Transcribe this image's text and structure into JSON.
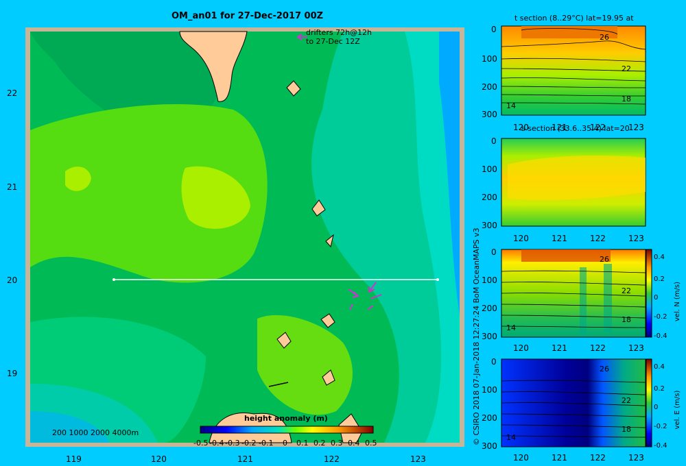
{
  "main_title": "OM_an01 for 27-Dec-2017 00Z",
  "drifters_line1": "drifters 72h@12h",
  "drifters_line2": "to 27-Dec 12Z",
  "depth_legend": "200  1000  2000  4000m",
  "credit": "© CSIRO 2018   07-Jan-2018 12:27:24 BoM OceanMAPS v3",
  "colorbar": {
    "title": "height anomaly (m)",
    "ticks": [
      "-0.5",
      "-0.4",
      "-0.3",
      "-0.2",
      "-0.1",
      "0",
      "0.1",
      "0.2",
      "0.3",
      "0.4",
      "0.5"
    ]
  },
  "panel_titles": [
    "t section (8..29°C) lat=19.95 at",
    "s section (33.6..35.4) lat=20"
  ],
  "vel_labels": [
    "vel. N (m/s)",
    "vel. E (m/s)"
  ],
  "vel_ticks": [
    "0.4",
    "0.2",
    "0",
    "-0.2",
    "-0.4"
  ],
  "colors": {
    "background": "#00ccff",
    "land": "#ffcc99",
    "bathy": "#c8b496"
  },
  "chart_data": [
    {
      "type": "heatmap",
      "title": "OM_an01 for 27-Dec-2017 00Z",
      "variable": "height anomaly (m)",
      "x_ticks": [
        "119",
        "120",
        "121",
        "122",
        "123"
      ],
      "y_ticks": [
        "22",
        "21",
        "20",
        "19"
      ],
      "xlim": [
        118.5,
        123.5
      ],
      "ylim": [
        18.3,
        22.7
      ],
      "colorbar_range": [
        -0.5,
        0.5
      ],
      "section_line": {
        "lat": 20,
        "lon_from": 119.5,
        "lon_to": 123.2
      }
    },
    {
      "type": "heatmap",
      "title": "t section (8..29°C) lat=19.95 at",
      "x_ticks": [
        "120",
        "121",
        "122",
        "123"
      ],
      "y_ticks": [
        "0",
        "100",
        "200",
        "300"
      ],
      "contour_labels": [
        "26",
        "22",
        "18",
        "14"
      ]
    },
    {
      "type": "heatmap",
      "title": "s section (33.6..35.4) lat=20",
      "x_ticks": [
        "120",
        "121",
        "122",
        "123"
      ],
      "y_ticks": [
        "0",
        "100",
        "200",
        "300"
      ]
    },
    {
      "type": "heatmap",
      "title": "vel. N (m/s)",
      "x_ticks": [
        "120",
        "121",
        "122",
        "123"
      ],
      "y_ticks": [
        "0",
        "100",
        "200",
        "300"
      ],
      "contour_labels": [
        "26",
        "22",
        "18",
        "14"
      ],
      "colorbar_ticks": [
        "0.4",
        "0.2",
        "0",
        "-0.2",
        "-0.4"
      ]
    },
    {
      "type": "heatmap",
      "title": "vel. E (m/s)",
      "x_ticks": [
        "120",
        "121",
        "122",
        "123"
      ],
      "y_ticks": [
        "0",
        "100",
        "200",
        "300"
      ],
      "contour_labels": [
        "26",
        "22",
        "18",
        "14"
      ],
      "colorbar_ticks": [
        "0.4",
        "0.2",
        "0",
        "-0.2",
        "-0.4"
      ]
    }
  ]
}
